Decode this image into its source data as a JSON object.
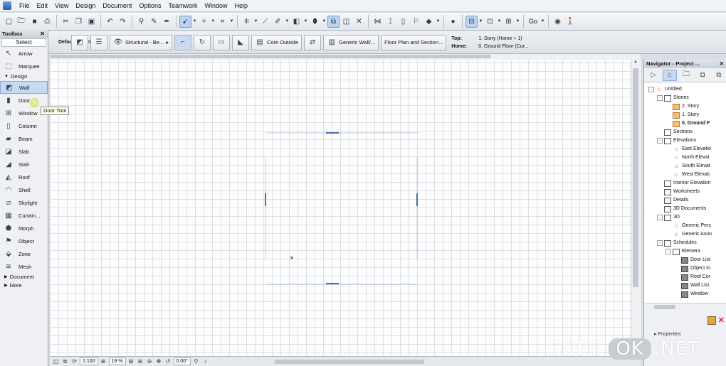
{
  "menu": [
    "File",
    "Edit",
    "View",
    "Design",
    "Document",
    "Options",
    "Teamwork",
    "Window",
    "Help"
  ],
  "toolbar": {
    "icons": [
      "new-icon",
      "open-icon",
      "save-icon",
      "print-icon",
      "cut-icon",
      "copy-icon",
      "paste-icon",
      "undo-icon",
      "redo-icon",
      "find-select-icon",
      "pick-up-icon",
      "inject-icon",
      "pointer-icon",
      "magic-wand-icon",
      "trace-icon",
      "layer-icon",
      "pen-icon",
      "ruler-icon",
      "grid-icon",
      "fill-icon",
      "suspend-group-icon",
      "lock-icon",
      "3d-icon",
      "zoom-icon",
      "window-icon",
      "floor-plan-icon",
      "display-icon"
    ],
    "go_label": "Go"
  },
  "infobox": {
    "settings_label": "Default Settings",
    "structure": "Structural - Be...",
    "reference_line": "Core Outside",
    "material": "Generic Wall/...",
    "display": "Floor Plan and Section...",
    "top_label": "Top:",
    "top_value": "1. Story (Home + 1)",
    "home_label": "Home:",
    "home_value": "0. Ground Floor (Cur..."
  },
  "toolbox": {
    "title": "Toolbox",
    "select": "Select",
    "arrow": "Arrow",
    "marquee": "Marquee",
    "design_group": "Design",
    "tools": [
      "Wall",
      "Door",
      "Window",
      "Column",
      "Beam",
      "Slab",
      "Stair",
      "Roof",
      "Shell",
      "Skylight",
      "Curtain...",
      "Morph",
      "Object",
      "Zone",
      "Mesh"
    ],
    "document_group": "Document",
    "more_group": "More",
    "tooltip": "Door Tool"
  },
  "navigator": {
    "title": "Navigator - Project ...",
    "tree": [
      {
        "label": "Untitled",
        "depth": 0,
        "icon": "house",
        "exp": "-"
      },
      {
        "label": "Stories",
        "depth": 1,
        "icon": "box",
        "exp": "-"
      },
      {
        "label": "2. Story",
        "depth": 2,
        "icon": "story",
        "exp": ""
      },
      {
        "label": "1. Story",
        "depth": 2,
        "icon": "story",
        "exp": ""
      },
      {
        "label": "0. Ground F",
        "depth": 2,
        "icon": "story",
        "exp": "",
        "bold": true
      },
      {
        "label": "Sections",
        "depth": 1,
        "icon": "box",
        "exp": ""
      },
      {
        "label": "Elevations",
        "depth": 1,
        "icon": "box",
        "exp": "-"
      },
      {
        "label": "East Elevatio",
        "depth": 2,
        "icon": "house",
        "exp": ""
      },
      {
        "label": "North Elevat",
        "depth": 2,
        "icon": "house",
        "exp": ""
      },
      {
        "label": "South Elevat",
        "depth": 2,
        "icon": "house",
        "exp": ""
      },
      {
        "label": "West Elevati",
        "depth": 2,
        "icon": "house",
        "exp": ""
      },
      {
        "label": "Interior Elevation",
        "depth": 1,
        "icon": "box",
        "exp": ""
      },
      {
        "label": "Worksheets",
        "depth": 1,
        "icon": "doc",
        "exp": ""
      },
      {
        "label": "Details",
        "depth": 1,
        "icon": "doc",
        "exp": ""
      },
      {
        "label": "3D Documents",
        "depth": 1,
        "icon": "doc",
        "exp": ""
      },
      {
        "label": "3D",
        "depth": 1,
        "icon": "box",
        "exp": "-"
      },
      {
        "label": "Generic Pers",
        "depth": 2,
        "icon": "house",
        "exp": ""
      },
      {
        "label": "Generic Axon",
        "depth": 2,
        "icon": "house",
        "exp": ""
      },
      {
        "label": "Schedules",
        "depth": 1,
        "icon": "box",
        "exp": "-"
      },
      {
        "label": "Element",
        "depth": 2,
        "icon": "box",
        "exp": "-"
      },
      {
        "label": "Door List",
        "depth": 3,
        "icon": "grid",
        "exp": ""
      },
      {
        "label": "Object In",
        "depth": 3,
        "icon": "grid",
        "exp": ""
      },
      {
        "label": "Roof Cor",
        "depth": 3,
        "icon": "grid",
        "exp": ""
      },
      {
        "label": "Wall List",
        "depth": 3,
        "icon": "grid",
        "exp": ""
      },
      {
        "label": "Window",
        "depth": 3,
        "icon": "grid",
        "exp": ""
      }
    ],
    "properties_label": "Properties"
  },
  "statusbar": {
    "scale": "1:100",
    "zoom": "19 %",
    "angle": "0.00°"
  },
  "watermark": {
    "left": "SOFT-",
    "middle": "OK",
    "right": ".NET"
  },
  "colors": {
    "accent": "#c6d9f3",
    "grid": "#dcdfe4",
    "door_marker": "#4a6fa5"
  }
}
